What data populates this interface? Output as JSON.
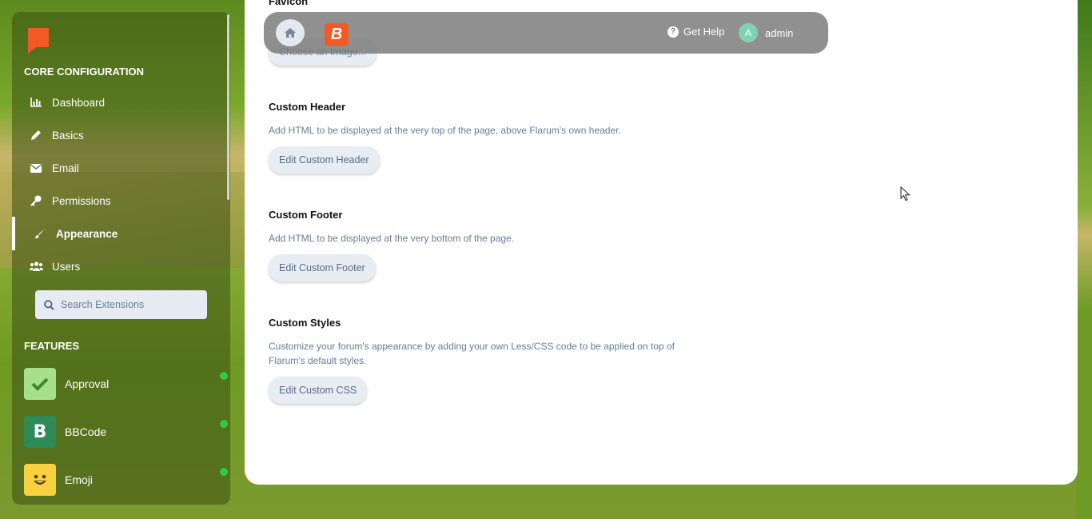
{
  "sidebar": {
    "group_core": "CORE CONFIGURATION",
    "items": [
      {
        "label": "Dashboard",
        "icon": "bar-chart-icon"
      },
      {
        "label": "Basics",
        "icon": "pencil-icon"
      },
      {
        "label": "Email",
        "icon": "envelope-icon"
      },
      {
        "label": "Permissions",
        "icon": "key-icon"
      },
      {
        "label": "Appearance",
        "icon": "paintbrush-icon",
        "active": true
      },
      {
        "label": "Users",
        "icon": "users-icon"
      }
    ],
    "search_placeholder": "Search Extensions",
    "group_features": "FEATURES",
    "extensions": [
      {
        "label": "Approval",
        "color": "#a6e089",
        "enabled": true
      },
      {
        "label": "BBCode",
        "color": "#2e8b57",
        "enabled": true
      },
      {
        "label": "Emoji",
        "color": "#f8d140",
        "enabled": true
      }
    ]
  },
  "topbar": {
    "help_label": "Get Help",
    "avatar_letter": "A",
    "user_name": "admin",
    "logo_letter": "B"
  },
  "main": {
    "favicon_title": "Favicon",
    "favicon_button": "Choose an Image...",
    "header_title": "Custom Header",
    "header_desc": "Add HTML to be displayed at the very top of the page, above Flarum's own header.",
    "header_button": "Edit Custom Header",
    "footer_title": "Custom Footer",
    "footer_desc": "Add HTML to be displayed at the very bottom of the page.",
    "footer_button": "Edit Custom Footer",
    "styles_title": "Custom Styles",
    "styles_desc": "Customize your forum's appearance by adding your own Less/CSS code to be applied on top of Flarum's default styles.",
    "styles_button": "Edit Custom CSS"
  },
  "colors": {
    "accent": "#f15a24",
    "status_enabled": "#2ecc40"
  }
}
